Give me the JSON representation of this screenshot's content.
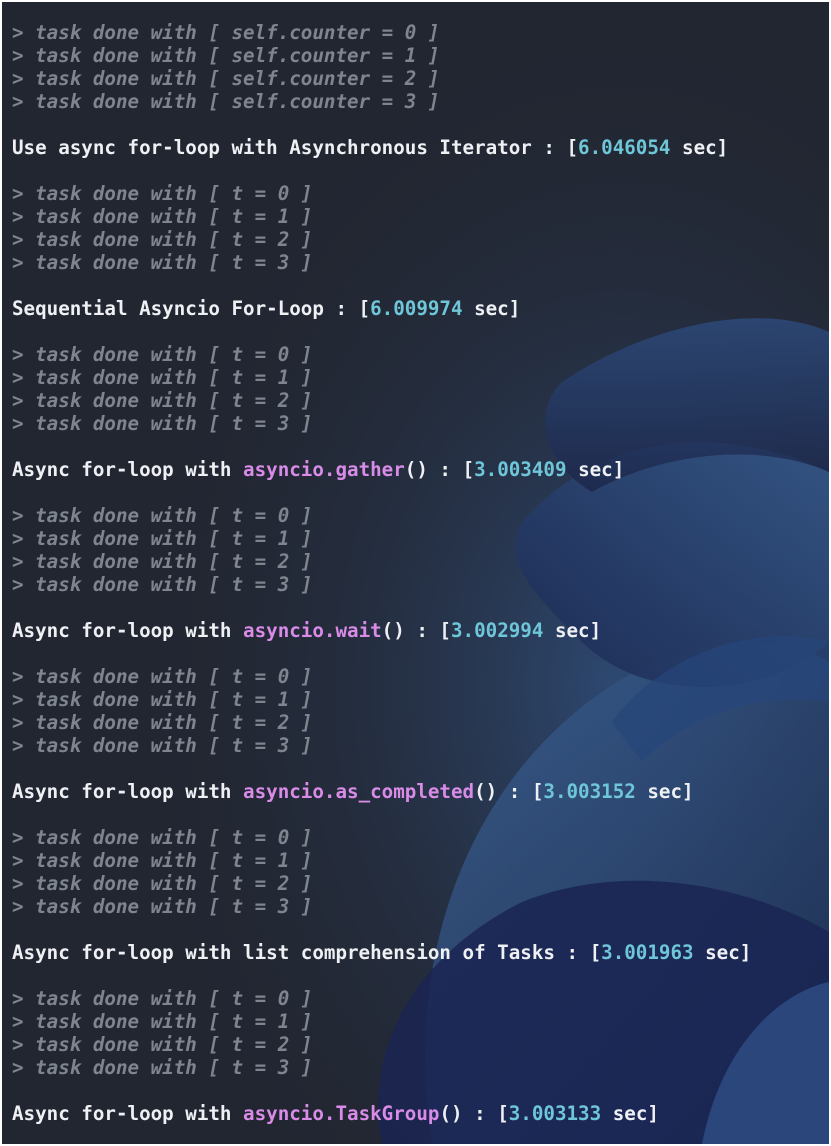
{
  "theme": {
    "background": "#222631",
    "log_color": "#7f858f",
    "text_color": "#eef0f4",
    "function_color": "#d98be8",
    "number_color": "#6ec6d8"
  },
  "blocks": [
    {
      "logs": [
        "> task done with [ self.counter = 0 ]",
        "> task done with [ self.counter = 1 ]",
        "> task done with [ self.counter = 2 ]",
        "> task done with [ self.counter = 3 ]"
      ],
      "summary": {
        "prefix": "Use async for-loop with Asynchronous Iterator : [",
        "func": "",
        "func_suffix": "",
        "time": "6.046054",
        "suffix": " sec]"
      }
    },
    {
      "logs": [
        "> task done with [ t = 0 ]",
        "> task done with [ t = 1 ]",
        "> task done with [ t = 2 ]",
        "> task done with [ t = 3 ]"
      ],
      "summary": {
        "prefix": "Sequential Asyncio For-Loop : [",
        "func": "",
        "func_suffix": "",
        "time": "6.009974",
        "suffix": " sec]"
      }
    },
    {
      "logs": [
        "> task done with [ t = 0 ]",
        "> task done with [ t = 1 ]",
        "> task done with [ t = 2 ]",
        "> task done with [ t = 3 ]"
      ],
      "summary": {
        "prefix": "Async for-loop with ",
        "func": "asyncio.gather",
        "func_suffix": "() : [",
        "time": "3.003409",
        "suffix": " sec]"
      }
    },
    {
      "logs": [
        "> task done with [ t = 0 ]",
        "> task done with [ t = 1 ]",
        "> task done with [ t = 2 ]",
        "> task done with [ t = 3 ]"
      ],
      "summary": {
        "prefix": "Async for-loop with ",
        "func": "asyncio.wait",
        "func_suffix": "() : [",
        "time": "3.002994",
        "suffix": " sec]"
      }
    },
    {
      "logs": [
        "> task done with [ t = 0 ]",
        "> task done with [ t = 1 ]",
        "> task done with [ t = 2 ]",
        "> task done with [ t = 3 ]"
      ],
      "summary": {
        "prefix": "Async for-loop with ",
        "func": "asyncio.as_completed",
        "func_suffix": "() : [",
        "time": "3.003152",
        "suffix": " sec]"
      }
    },
    {
      "logs": [
        "> task done with [ t = 0 ]",
        "> task done with [ t = 1 ]",
        "> task done with [ t = 2 ]",
        "> task done with [ t = 3 ]"
      ],
      "summary": {
        "prefix": "Async for-loop with list comprehension of Tasks : [",
        "func": "",
        "func_suffix": "",
        "time": "3.001963",
        "suffix": " sec]"
      }
    },
    {
      "logs": [
        "> task done with [ t = 0 ]",
        "> task done with [ t = 1 ]",
        "> task done with [ t = 2 ]",
        "> task done with [ t = 3 ]"
      ],
      "summary": {
        "prefix": "Async for-loop with ",
        "func": "asyncio.TaskGroup",
        "func_suffix": "() : [",
        "time": "3.003133",
        "suffix": " sec]"
      }
    }
  ]
}
